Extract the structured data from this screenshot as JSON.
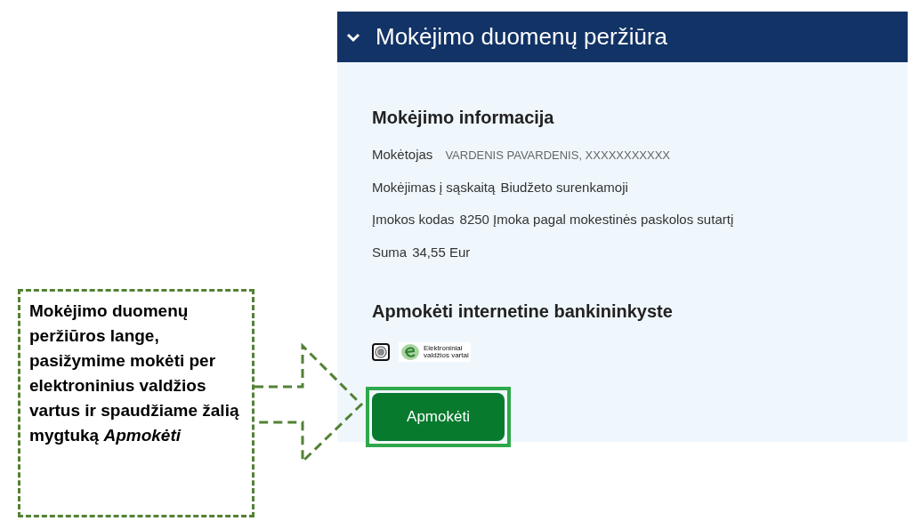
{
  "panel": {
    "title": "Mokėjimo duomenų peržiūra",
    "expanded": true
  },
  "payment_info": {
    "heading": "Mokėjimo informacija",
    "rows": [
      {
        "kind": "masked",
        "label": "Mokėtojas",
        "value": "VARDENIS PAVARDENIS, XXXXXXXXXXX"
      },
      {
        "kind": "plain",
        "label": "Mokėjimas į sąskaitą",
        "value": "Biudžeto surenkamoji"
      },
      {
        "kind": "plain",
        "label": "Įmokos kodas",
        "value": "8250 Įmoka pagal mokestinės paskolos sutartį"
      },
      {
        "kind": "plain",
        "label": "Suma",
        "value": "34,55 Eur"
      }
    ]
  },
  "bank_payment": {
    "heading": "Apmokėti internetine bankininkyste",
    "options": [
      {
        "logo_lines": [
          "Elektroniniai",
          "valdžios vartai"
        ],
        "selected": true
      }
    ]
  },
  "pay_button": {
    "label": "Apmokėti",
    "highlighted": true
  },
  "callout": {
    "text": "Mokėjimo duomenų peržiūros lange, pasižymime mokėti per elektroninius valdžios vartus ir spaudžiame žalią mygtuką *Apmokėti*"
  }
}
